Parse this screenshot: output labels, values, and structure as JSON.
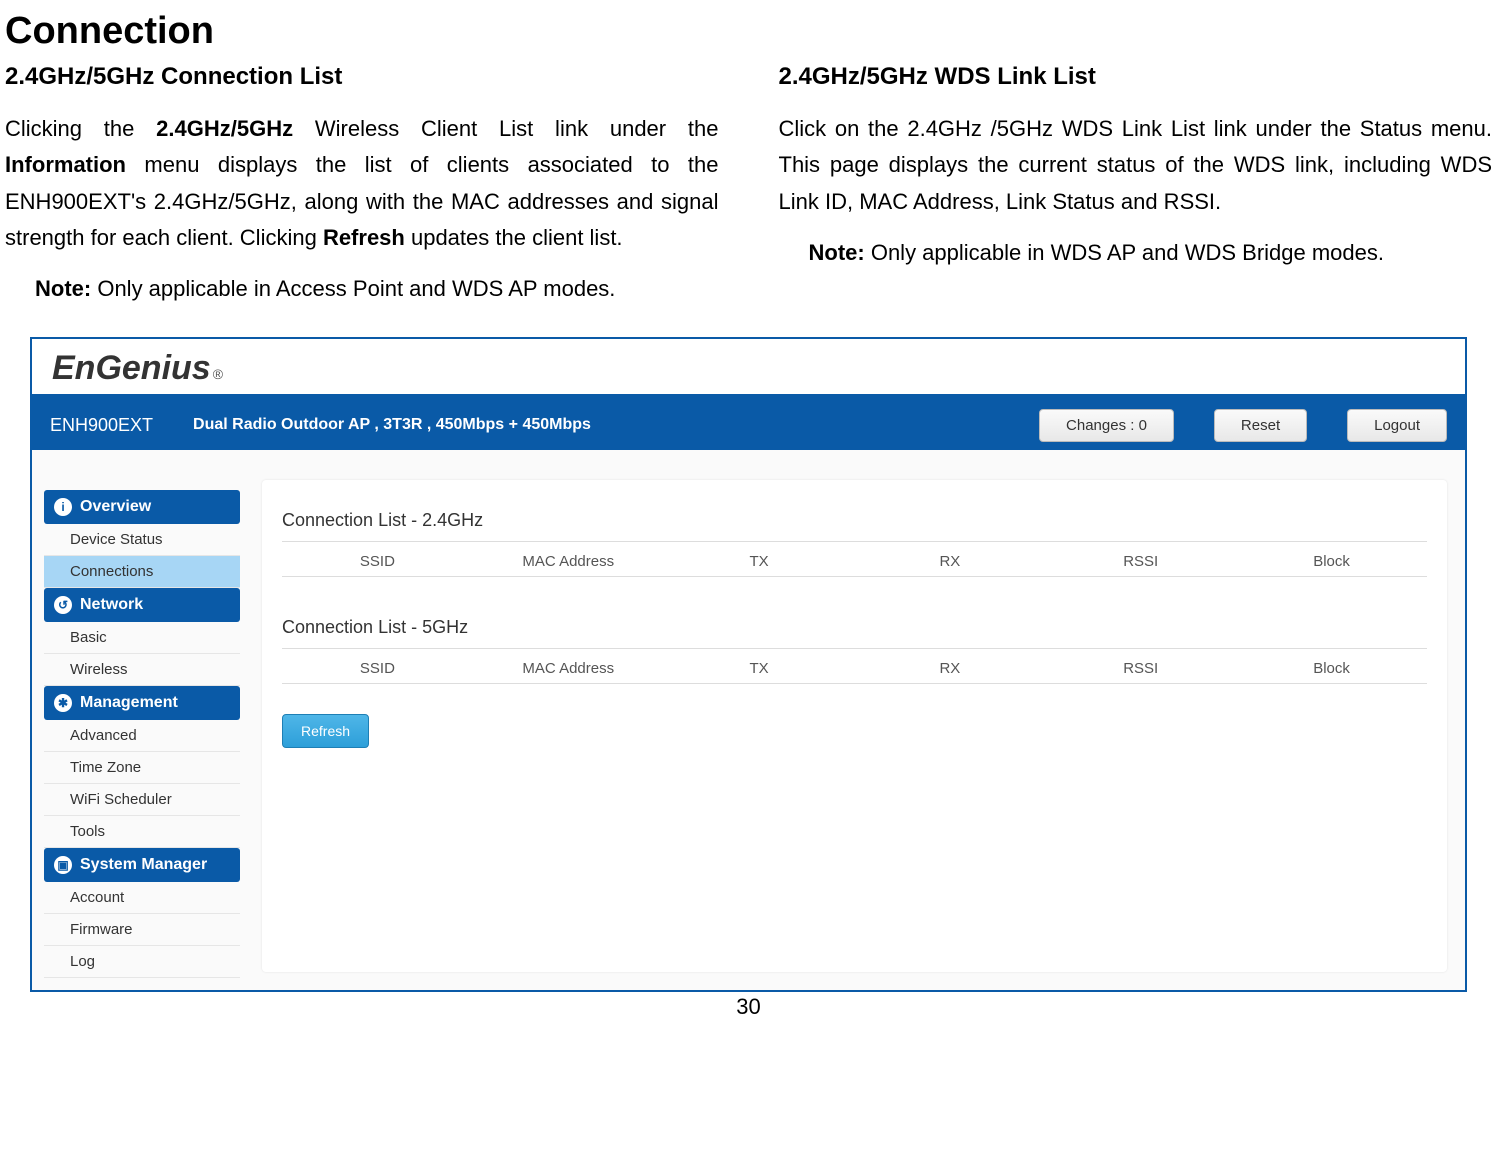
{
  "doc": {
    "title": "Connection",
    "left": {
      "heading": "2.4GHz/5GHz Connection List",
      "p1a": "Clicking the ",
      "p1b": "2.4GHz/5GHz",
      "p1c": " Wireless Client List link under the ",
      "p1d": "Information",
      "p1e": " menu displays the list of clients associated to the ENH900EXT's 2.4GHz/5GHz, along with the MAC addresses and signal strength for each client. Clicking ",
      "p1f": "Refresh",
      "p1g": " updates the client list.",
      "note_label": "Note:",
      "note_body": " Only applicable in Access Point and WDS AP modes."
    },
    "right": {
      "heading": "2.4GHz/5GHz WDS Link List",
      "p1": "Click on the 2.4GHz /5GHz WDS Link List link under the Status menu. This page displays the current status of the WDS link, including WDS Link ID, MAC Address, Link Status and RSSI.",
      "note_label": "Note:",
      "note_body": " Only applicable in WDS AP and WDS Bridge modes."
    },
    "page_number": "30"
  },
  "ui": {
    "logo": "EnGenius",
    "logo_reg": "®",
    "model": "ENH900EXT",
    "model_desc": "Dual Radio Outdoor AP , 3T3R , 450Mbps + 450Mbps",
    "buttons": {
      "changes": "Changes : 0",
      "reset": "Reset",
      "logout": "Logout"
    },
    "nav": {
      "overview": {
        "header": "Overview",
        "items": [
          "Device Status",
          "Connections"
        ]
      },
      "network": {
        "header": "Network",
        "items": [
          "Basic",
          "Wireless"
        ]
      },
      "management": {
        "header": "Management",
        "items": [
          "Advanced",
          "Time Zone",
          "WiFi Scheduler",
          "Tools"
        ]
      },
      "system": {
        "header": "System Manager",
        "items": [
          "Account",
          "Firmware",
          "Log"
        ]
      }
    },
    "content": {
      "list24_title": "Connection List - 2.4GHz",
      "list5_title": "Connection List - 5GHz",
      "cols": [
        "SSID",
        "MAC Address",
        "TX",
        "RX",
        "RSSI",
        "Block"
      ],
      "refresh": "Refresh"
    }
  }
}
